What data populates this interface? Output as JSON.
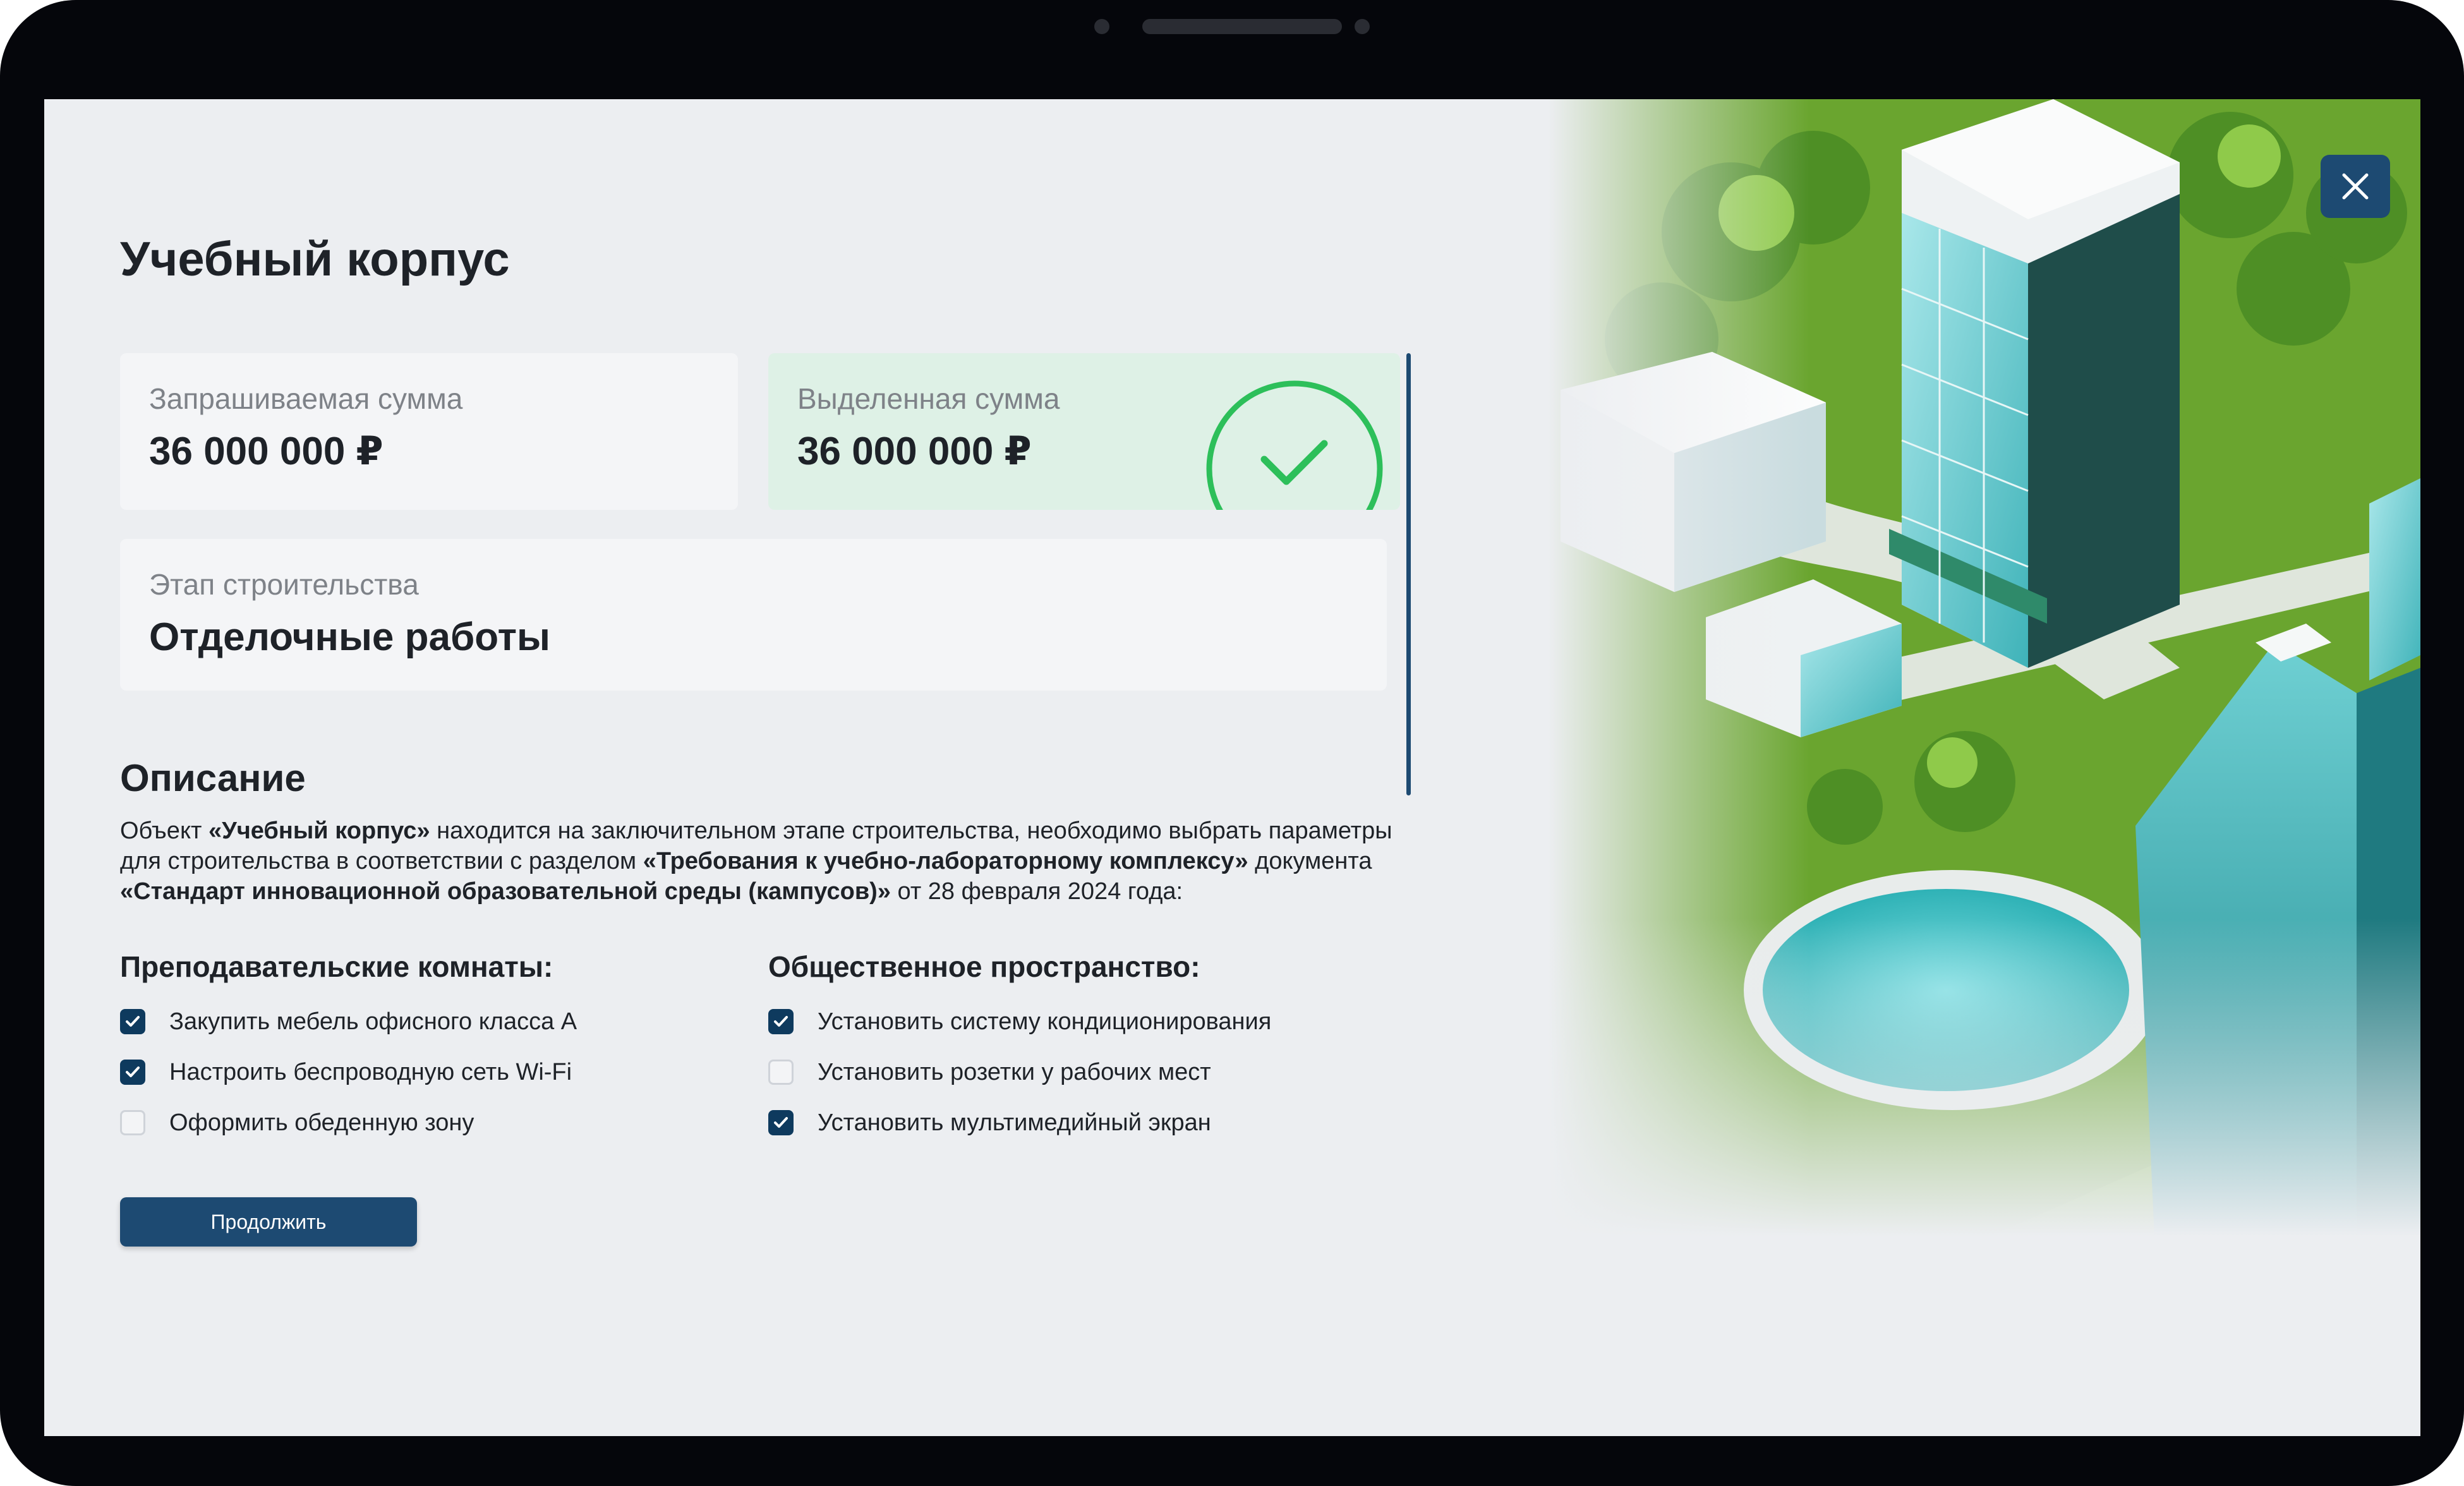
{
  "page": {
    "title": "Учебный корпус"
  },
  "summary": {
    "requested_label": "Запрашиваемая сумма",
    "requested_value": "36 000 000 ₽",
    "allocated_label": "Выделенная сумма",
    "allocated_value": "36 000 000 ₽",
    "allocated_status_icon": "check-circle-icon",
    "stage_label": "Этап строительства",
    "stage_value": "Отделочные работы"
  },
  "description": {
    "title": "Описание",
    "t1": "Объект ",
    "b1": "«Учебный корпус»",
    "t2": " находится на заключительном этапе строительства, необходимо выбрать параметры для строительства в соответствии с разделом ",
    "b2": "«Требования к учебно-лабораторному комплексу»",
    "t3": " документа ",
    "b3": "«Стандарт инновационной образовательной среды (кампусов)»",
    "t4": " от 28 февраля 2024 года:"
  },
  "groups": [
    {
      "title": "Преподавательские комнаты:",
      "items": [
        {
          "label": "Закупить мебель офисного класса А",
          "checked": true
        },
        {
          "label": "Настроить беспроводную сеть Wi-Fi",
          "checked": true
        },
        {
          "label": "Оформить обеденную зону",
          "checked": false
        }
      ]
    },
    {
      "title": "Общественное пространство:",
      "items": [
        {
          "label": "Установить систему кондиционирования",
          "checked": true
        },
        {
          "label": "Установить розетки у рабочих мест",
          "checked": false
        },
        {
          "label": "Установить мультимедийный экран",
          "checked": true
        }
      ]
    }
  ],
  "actions": {
    "continue_label": "Продолжить",
    "close_icon": "close-icon"
  },
  "colors": {
    "accent": "#1d4a72",
    "success": "#2dbf5a",
    "allocated_bg": "#def1e6",
    "background": "#eceef1"
  }
}
